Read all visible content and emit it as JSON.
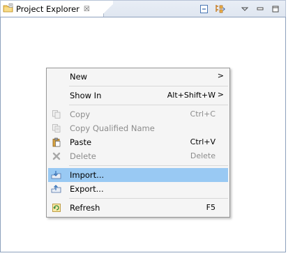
{
  "view": {
    "title": "Project Explorer",
    "close_glyph": "☒",
    "toolbar": {
      "collapse_icon": "collapse-all-icon",
      "link_icon": "link-with-editor-icon",
      "menu_icon": "view-menu-icon",
      "minimize_icon": "minimize-icon",
      "maximize_icon": "maximize-icon"
    }
  },
  "menu": {
    "items": [
      {
        "label": "New",
        "accel": "",
        "submenu_glyph": ">"
      },
      {
        "label": "Show In",
        "accel": "Alt+Shift+W",
        "submenu_glyph": ">"
      },
      {
        "label": "Copy",
        "accel": "Ctrl+C"
      },
      {
        "label": "Copy Qualified Name",
        "accel": ""
      },
      {
        "label": "Paste",
        "accel": "Ctrl+V"
      },
      {
        "label": "Delete",
        "accel": "Delete"
      },
      {
        "label": "Import...",
        "accel": ""
      },
      {
        "label": "Export...",
        "accel": ""
      },
      {
        "label": "Refresh",
        "accel": "F5"
      }
    ]
  },
  "colors": {
    "highlight": "#99c9f3",
    "disabled_text": "#8c8c8c",
    "menu_bg": "#f5f5f5"
  }
}
